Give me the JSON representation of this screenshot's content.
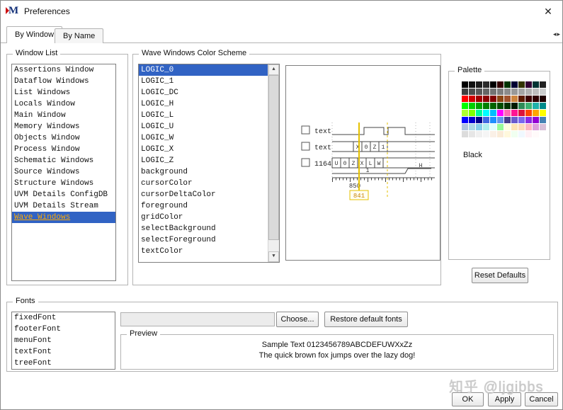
{
  "window": {
    "title": "Preferences"
  },
  "titlebar": {
    "app_icon_letter": "M"
  },
  "icons": {
    "close": "✕",
    "scroll_left": "◂",
    "scroll_right": "▸",
    "up_arrow": "▲",
    "down_arrow": "▼"
  },
  "tabs": {
    "by_window": "By Window",
    "by_name": "By Name"
  },
  "window_list": {
    "label": "Window List",
    "items": [
      "Assertions Window",
      "Dataflow Windows",
      "List Windows",
      "Locals Window",
      "Main Window",
      "Memory Windows",
      "Objects Window",
      "Process Window",
      "Schematic Windows",
      "Source Windows",
      "Structure Windows",
      "UVM Details ConfigDB",
      "UVM Details Stream",
      "Wave Windows"
    ],
    "selected": "Wave Windows"
  },
  "color_scheme": {
    "label": "Wave Windows Color Scheme",
    "items": [
      "LOGIC_0",
      "LOGIC_1",
      "LOGIC_DC",
      "LOGIC_H",
      "LOGIC_L",
      "LOGIC_U",
      "LOGIC_W",
      "LOGIC_X",
      "LOGIC_Z",
      "background",
      "cursorColor",
      "cursorDeltaColor",
      "foreground",
      "gridColor",
      "selectBackground",
      "selectForeground",
      "textColor"
    ],
    "selected": "LOGIC_0"
  },
  "wave_preview": {
    "signal_labels": [
      "text",
      "text",
      "1164"
    ],
    "row2_values": [
      "X",
      "0",
      "Z",
      "1"
    ],
    "row3_values": [
      "U",
      "0",
      "Z",
      "X",
      "L",
      "W"
    ],
    "row4_left_value": "1",
    "row4_right_value": "H",
    "cursor_time": "850",
    "cursor_delta": "841"
  },
  "palette": {
    "label": "Palette",
    "selected_name": "Black",
    "colors": [
      [
        "#000000",
        "#111111",
        "#1c1c1c",
        "#2a2a2a",
        "#000000",
        "#330000",
        "#003300",
        "#000033",
        "#333300",
        "#330033",
        "#003333",
        "#222222"
      ],
      [
        "#3f3f3f",
        "#4c4c4c",
        "#595959",
        "#666666",
        "#737373",
        "#7f7f7f",
        "#8c8c8c",
        "#999999",
        "#a5a5a5",
        "#b2b2b2",
        "#bfbfbf",
        "#cccccc"
      ],
      [
        "#ff0000",
        "#d10000",
        "#a30000",
        "#8b0000",
        "#800000",
        "#8b4513",
        "#a0522d",
        "#cd853f",
        "#5c1a00",
        "#3d0000",
        "#2e0000",
        "#1f0000"
      ],
      [
        "#00ff00",
        "#00d100",
        "#00a300",
        "#008000",
        "#006400",
        "#004d00",
        "#003300",
        "#001a00",
        "#2e8b57",
        "#3cb371",
        "#20b2aa",
        "#008b8b"
      ],
      [
        "#adff2f",
        "#7fff00",
        "#00fa9a",
        "#00ffff",
        "#00bfff",
        "#ff00ff",
        "#ff69b4",
        "#ff1493",
        "#dc143c",
        "#ff4500",
        "#ffa500",
        "#ffff00"
      ],
      [
        "#0000ff",
        "#0000cd",
        "#00008b",
        "#4169e1",
        "#1e90ff",
        "#6495ed",
        "#483d8b",
        "#6a5acd",
        "#7b68ee",
        "#8a2be2",
        "#9400d3",
        "#4682b4"
      ],
      [
        "#b0c4de",
        "#add8e6",
        "#87ceeb",
        "#afeeee",
        "#e0ffff",
        "#98fb98",
        "#ffffe0",
        "#ffe4b5",
        "#ffdab9",
        "#ffb6c1",
        "#dda0dd",
        "#d8bfd8"
      ],
      [
        "#dcdcdc",
        "#e6e6e6",
        "#f0f0f0",
        "#f5f5f5",
        "#faf0e6",
        "#faebd7",
        "#fff8dc",
        "#f0fff0",
        "#f0f8ff",
        "#fff0f5",
        "#fffafa",
        "#ffffff"
      ]
    ]
  },
  "buttons": {
    "reset_defaults": "Reset Defaults",
    "choose": "Choose...",
    "restore_fonts": "Restore default fonts",
    "ok": "OK",
    "apply": "Apply",
    "cancel": "Cancel"
  },
  "fonts": {
    "label": "Fonts",
    "items": [
      "fixedFont",
      "footerFont",
      "menuFont",
      "textFont",
      "treeFont"
    ],
    "field_value": ""
  },
  "preview": {
    "label": "Preview",
    "line1": "Sample Text 0123456789ABCDEFUWXxZz",
    "line2": "The quick brown fox jumps over the lazy dog!"
  },
  "watermark": "知乎 @ljgibbs"
}
